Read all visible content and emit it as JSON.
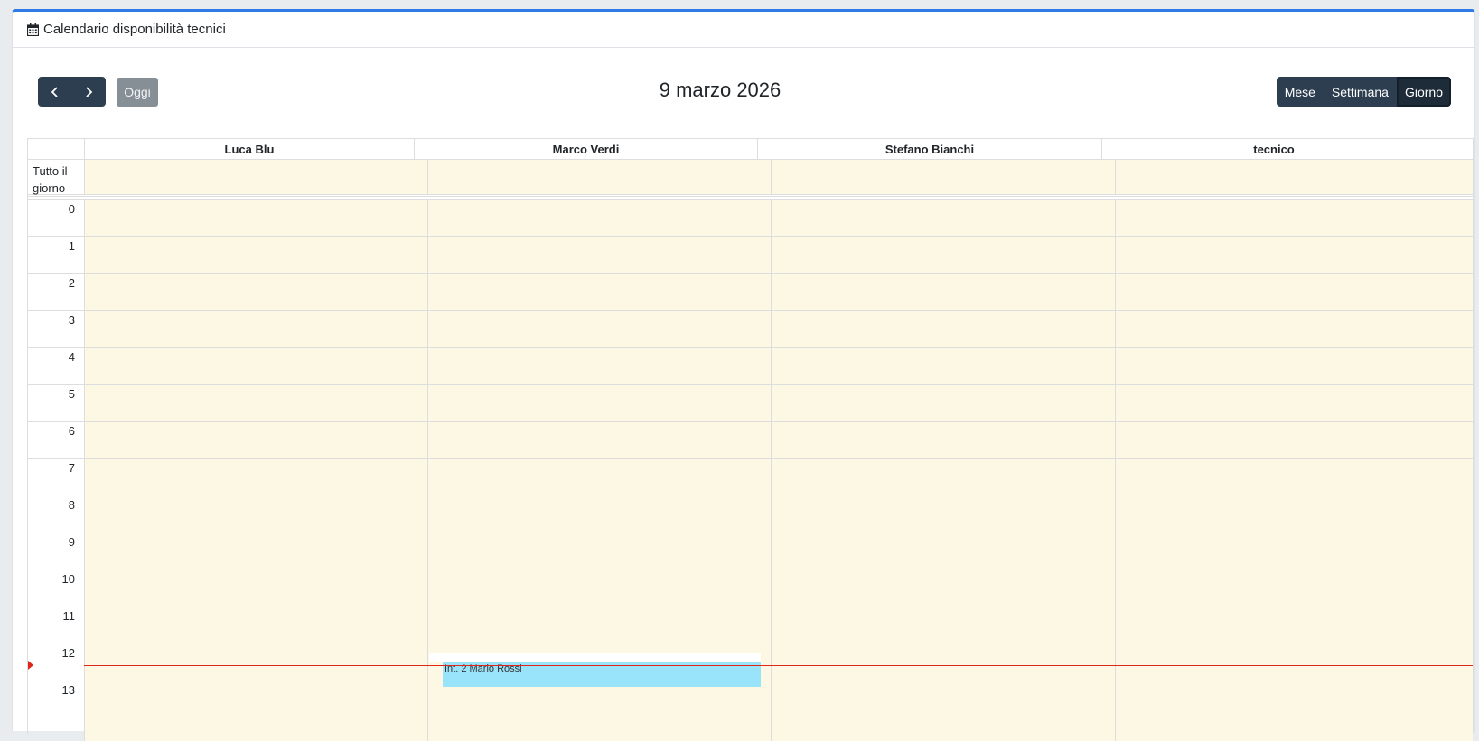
{
  "header": {
    "title": "Calendario disponibilità tecnici",
    "icon": "calendar-icon"
  },
  "toolbar": {
    "prev_icon": "chevron-left-icon",
    "next_icon": "chevron-right-icon",
    "today_label": "Oggi",
    "date_title": "9 marzo 2026",
    "views": [
      "Mese",
      "Settimana",
      "Giorno"
    ],
    "active_view": "Giorno"
  },
  "resources": [
    "Luca Blu",
    "Marco Verdi",
    "Stefano Bianchi",
    "tecnico"
  ],
  "allday_label": "Tutto il giorno",
  "hours": [
    "0",
    "1",
    "2",
    "3",
    "4",
    "5",
    "6",
    "7",
    "8",
    "9",
    "10",
    "11",
    "12",
    "13"
  ],
  "events": [
    {
      "title": "Int. 2 Mario Rossi",
      "resource": "Marco Verdi"
    }
  ],
  "colors": {
    "accent": "#2f7be5",
    "button_dark": "#2c3e50",
    "today_button": "#868e96",
    "slot_bg": "#fcf8e3",
    "event_bg": "#9ae4fb",
    "now_indicator": "#e0261b"
  }
}
